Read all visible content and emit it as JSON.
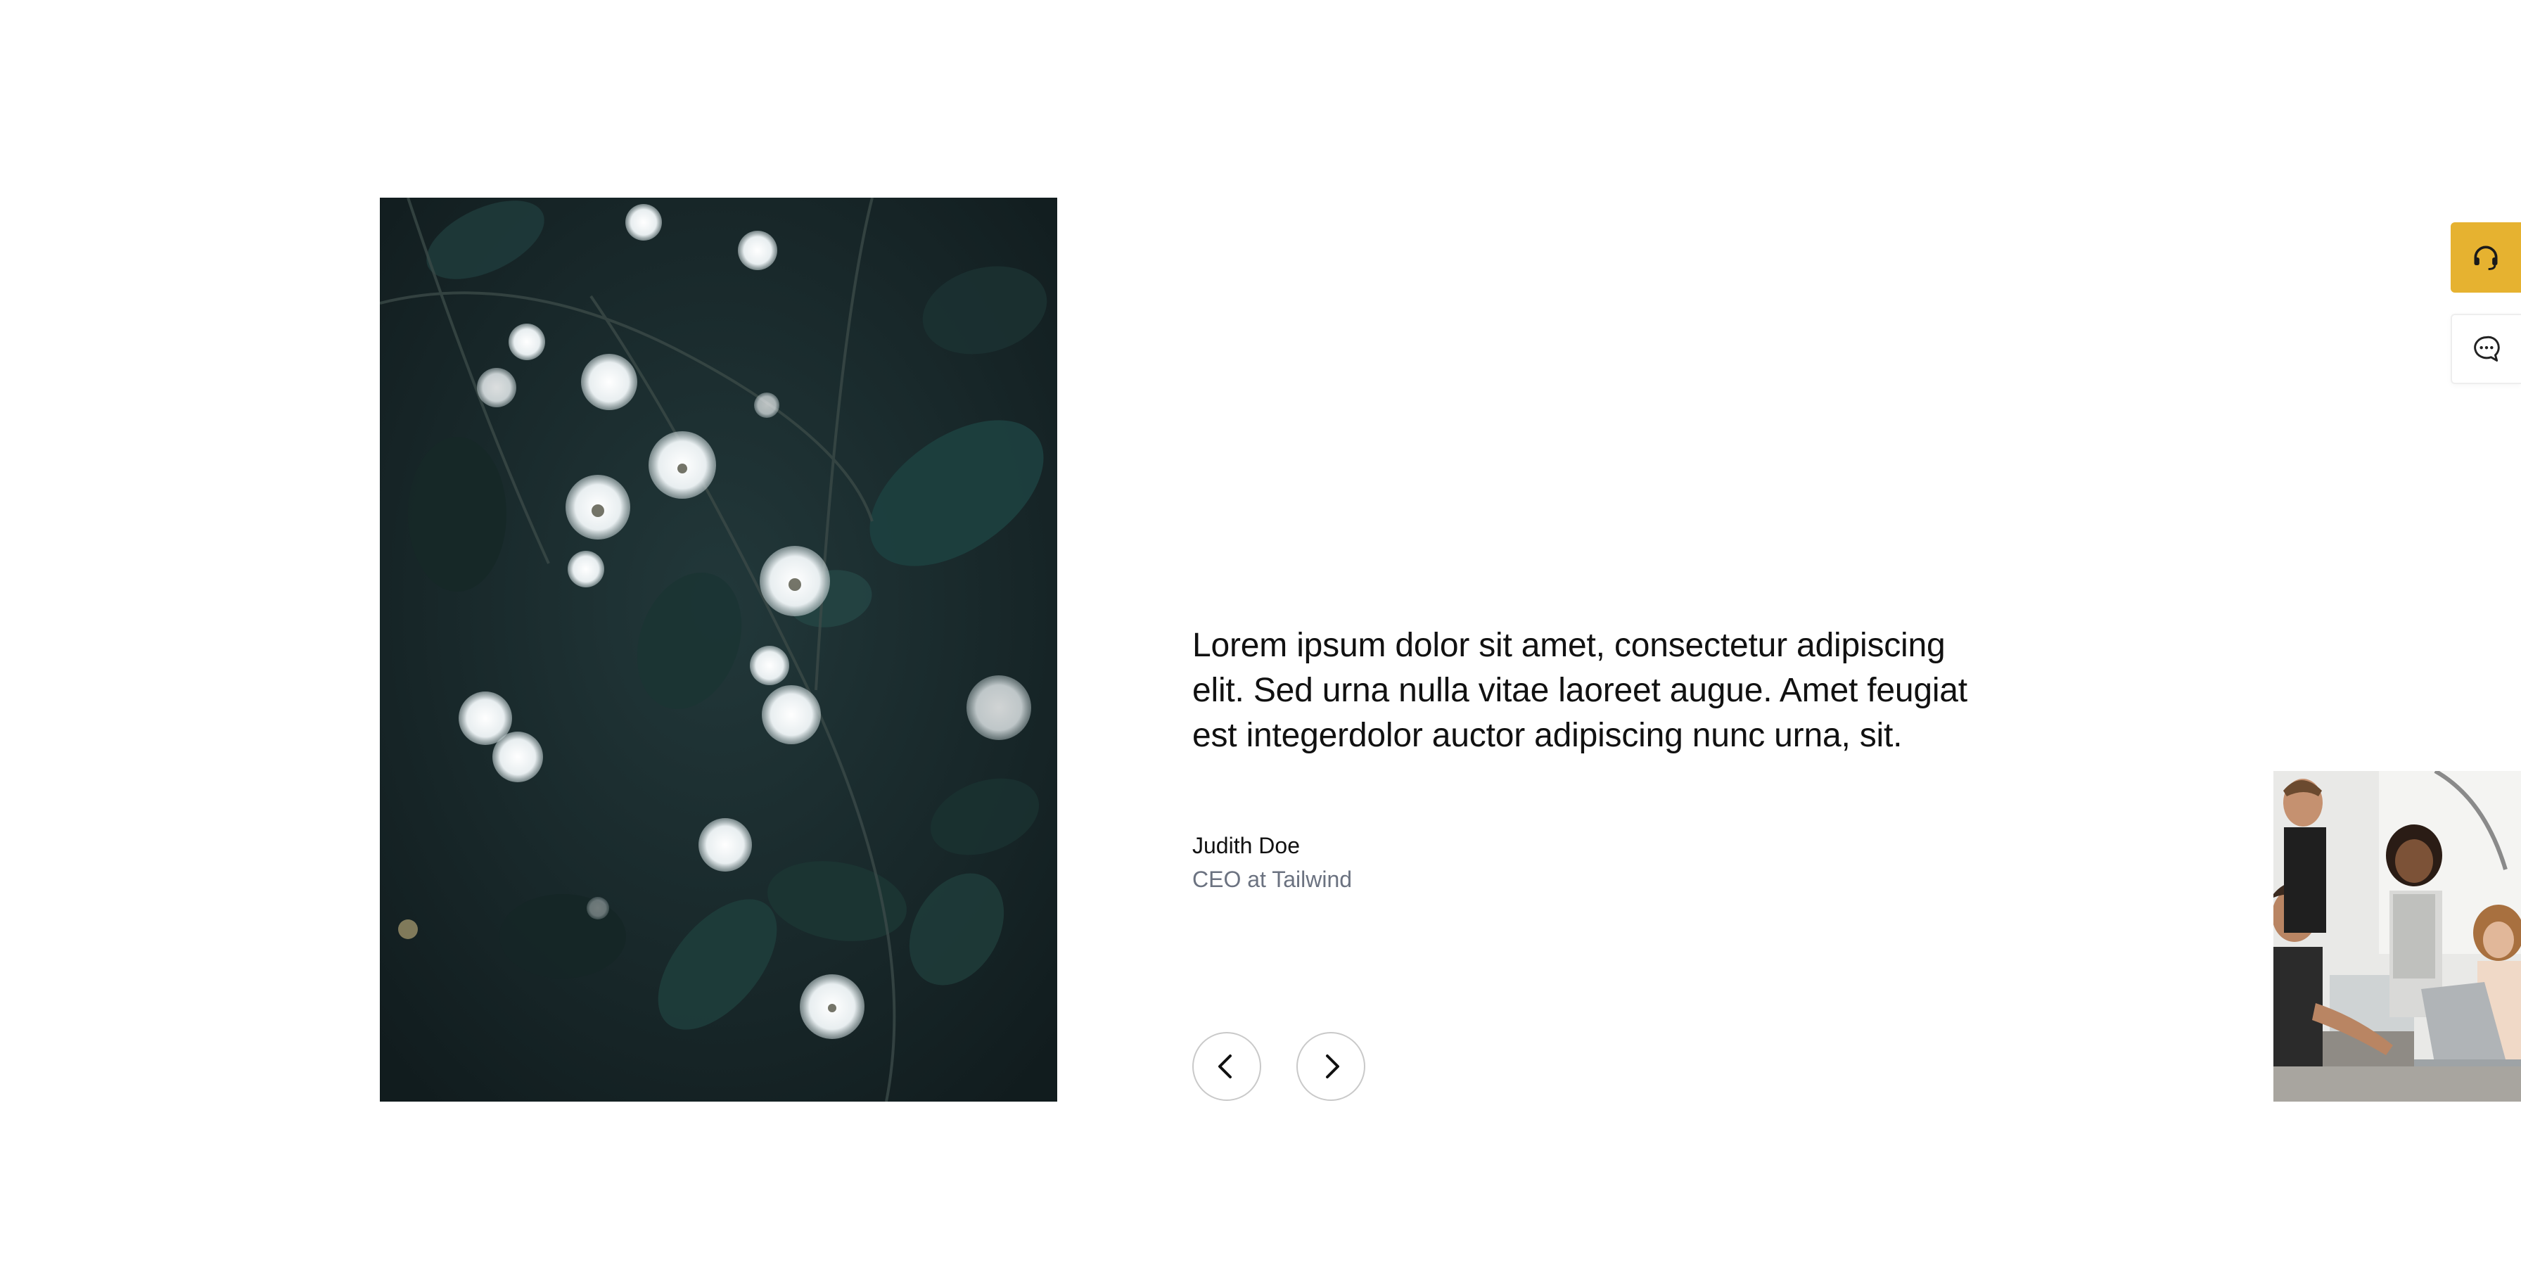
{
  "testimonial": {
    "quote": "Lorem ipsum dolor sit amet, consectetur adipiscing elit. Sed urna nulla vitae laoreet augue. Amet feugiat est integerdolor auctor adipiscing nunc urna, sit.",
    "author_name": "Judith Doe",
    "author_role": "CEO at Tailwind"
  },
  "images": {
    "main_icon": "flowers-photo",
    "preview_icon": "team-photo"
  },
  "navigation": {
    "prev_icon": "chevron-left-icon",
    "next_icon": "chevron-right-icon"
  },
  "side_widgets": {
    "support_icon": "headset-icon",
    "chat_icon": "chat-bubble-icon",
    "support_color": "#e6b230"
  },
  "colors": {
    "text_primary": "#111111",
    "text_secondary": "#6b7280",
    "accent": "#e6b230"
  }
}
